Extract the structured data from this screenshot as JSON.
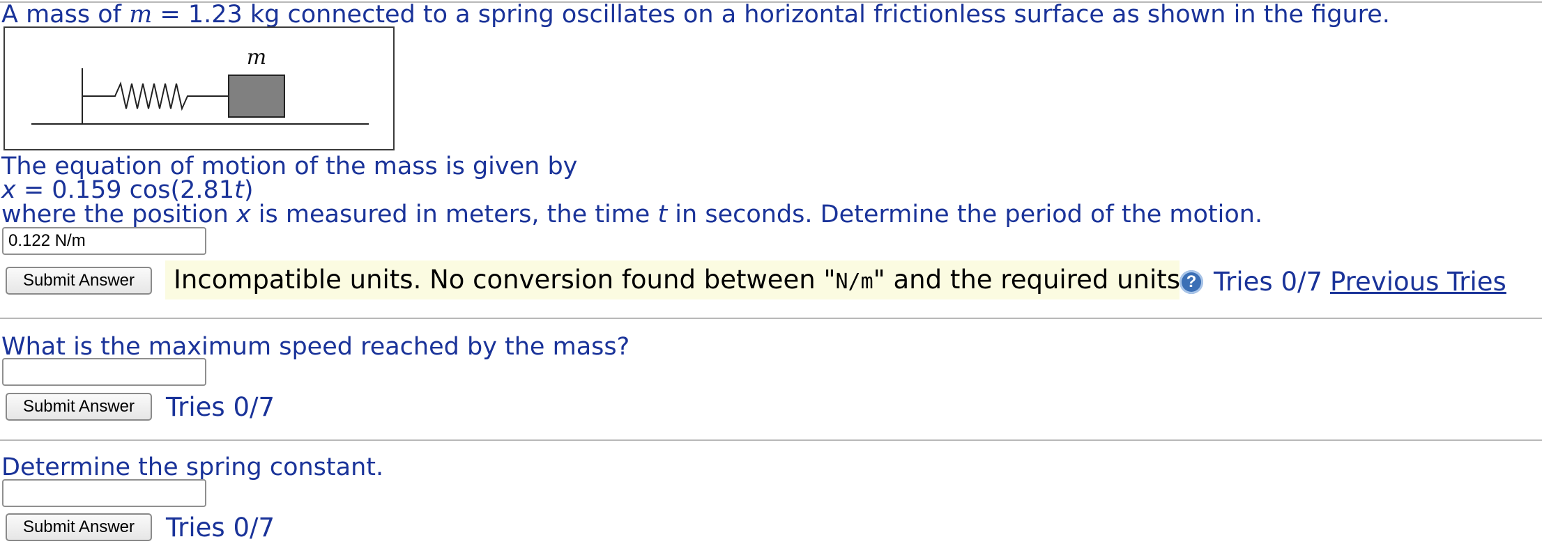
{
  "problem": {
    "intro": {
      "p1": "A mass of ",
      "m_var": "m",
      "p2": " = 1.23 kg connected to a spring oscillates on a horizontal frictionless surface as shown in the figure."
    },
    "figure": {
      "mass_label": "m"
    },
    "equation_intro": "The equation of motion of the mass is given by",
    "equation": {
      "x_var": "x",
      "p1": " = 0.159 cos(2.81",
      "t_var": "t",
      "p2": ")"
    },
    "where": {
      "p1": "where the position ",
      "x_var": "x",
      "p2": " is measured in meters, the time ",
      "t_var": "t",
      "p3": " in seconds. Determine the period of the motion."
    }
  },
  "part1": {
    "answer_value": "0.122 N/m",
    "submit_label": "Submit Answer",
    "feedback": {
      "p1": "Incompatible units. No conversion found between \"",
      "code": "N/m",
      "p2": "\" and the required units."
    },
    "help_icon": "question-circle-icon",
    "help_glyph": "?",
    "tries": "Tries 0/7",
    "previous_tries_label": "Previous Tries"
  },
  "part2": {
    "question": "What is the maximum speed reached by the mass?",
    "answer_value": "",
    "submit_label": "Submit Answer",
    "tries": "Tries 0/7"
  },
  "part3": {
    "question": "Determine the spring constant.",
    "answer_value": "",
    "submit_label": "Submit Answer",
    "tries": "Tries 0/7"
  },
  "colors": {
    "text": "#1a3399",
    "feedback_bg": "#fbfbe1",
    "block_fill": "#808080",
    "help_icon": "#3b6fb6"
  }
}
